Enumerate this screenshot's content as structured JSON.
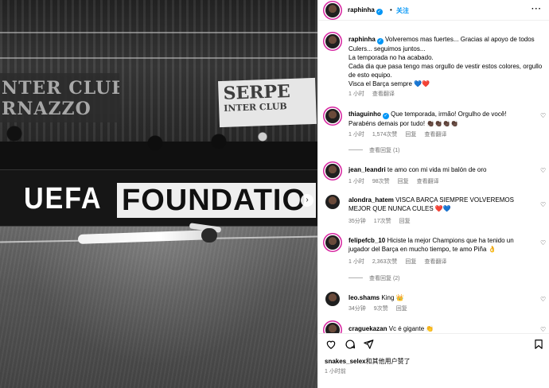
{
  "photo": {
    "banner_left_text": "NTER CLUB\nRNAZZO",
    "banner_right_big": "SERPE",
    "banner_right_small": "INTER CLUB",
    "adboard_uefa": "UEFA",
    "adboard_foundation": "FOUNDATIO",
    "next_arrow": "›"
  },
  "header": {
    "username": "raphinha",
    "dot": "•",
    "follow_label": "关注",
    "more_label": "···"
  },
  "caption": {
    "username": "raphinha",
    "text": "Volveremos mas fuertes... Gracias al apoyo de todos Culers... seguimos juntos...",
    "line2": "La temporada no ha acabado.",
    "line3": "Cada dia que pasa tengo mas orgullo de vestir estos colores, orgullo de esto equipo.",
    "line4": "Visca el Barça sempre 💙❤️",
    "time": "1 小时",
    "translate": "查看翻译"
  },
  "comments": [
    {
      "username": "thiaguinho",
      "verified": true,
      "text": "Que temporada, irmão! Orgulho de você! Parabéns demais por tudo! 👏🏿👏🏿👏🏿👏🏿",
      "time": "1 小时",
      "likes": "1,574次赞",
      "reply": "回复",
      "translate": "查看翻译",
      "replies": "查看回复 (1)"
    },
    {
      "username": "jean_leandri",
      "verified": false,
      "text": "te amo con mi vida mi balón de oro",
      "time": "1 小时",
      "likes": "98次赞",
      "reply": "回复",
      "translate": "查看翻译"
    },
    {
      "username": "alondra_hatem",
      "verified": false,
      "text": "VISCA BARÇA SIEMPRE VOLVEREMOS MEJOR QUE NUNCA CULES ❤️💙",
      "time": "35分钟",
      "likes": "17次赞",
      "reply": "回复"
    },
    {
      "username": "felipefcb_10",
      "verified": false,
      "text": "Hiciste la mejor Champions que ha tenido un jugador del Barça en mucho tiempo, te amo Piña 👌",
      "time": "1 小时",
      "likes": "2,363次赞",
      "reply": "回复",
      "translate": "查看翻译",
      "replies": "查看回复 (2)"
    },
    {
      "username": "leo.shams",
      "verified": false,
      "text": "King 👑",
      "time": "34分钟",
      "likes": "9次赞",
      "reply": "回复"
    },
    {
      "username": "craguekazan",
      "verified": false,
      "text": "Vc é gigante 👏"
    }
  ],
  "actions": {
    "liked_by_user": "snakes_selex",
    "liked_by_suffix": "和其他用户赞了",
    "time": "1 小时前"
  },
  "colors": {
    "accent": "#0095f6",
    "muted": "#737373",
    "border": "#efefef"
  }
}
